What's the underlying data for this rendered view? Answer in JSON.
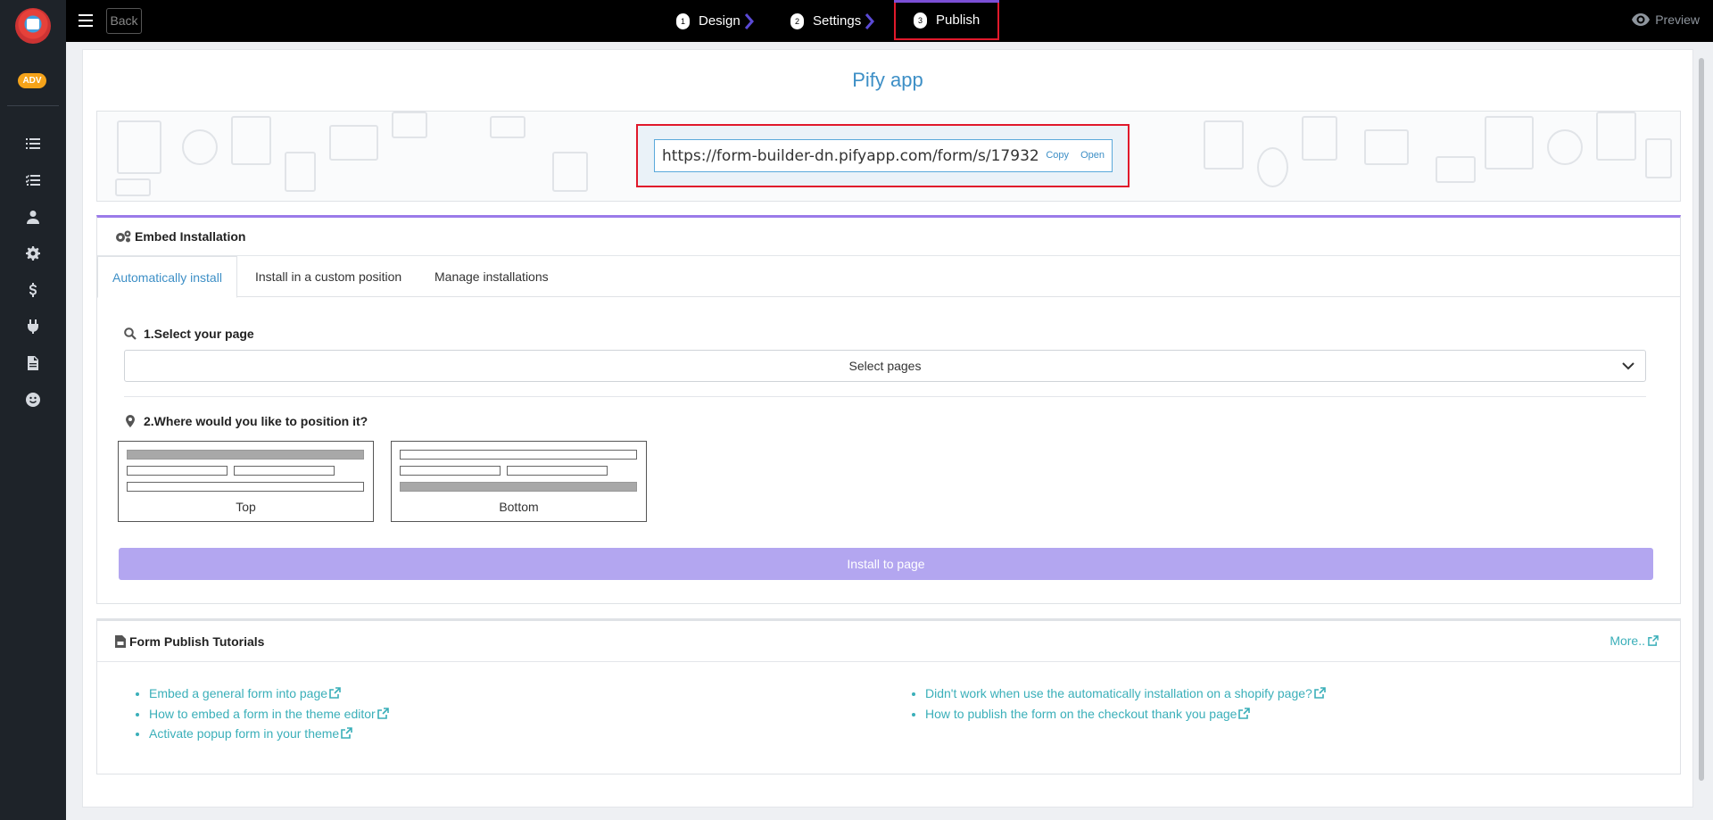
{
  "sidebar": {
    "badge": "ADV",
    "icons": [
      "list-icon",
      "checklist-icon",
      "user-icon",
      "gear-icon",
      "dollar-icon",
      "plug-icon",
      "document-icon",
      "smile-icon"
    ]
  },
  "topbar": {
    "back_label": "Back",
    "steps": [
      {
        "num": "1",
        "label": "Design"
      },
      {
        "num": "2",
        "label": "Settings"
      },
      {
        "num": "3",
        "label": "Publish"
      }
    ],
    "preview_label": "Preview"
  },
  "main": {
    "app_title": "Pify app",
    "form_url": "https://form-builder-dn.pifyapp.com/form/s/17932",
    "copy_label": "Copy",
    "open_label": "Open"
  },
  "embed": {
    "title": "Embed Installation",
    "tabs": [
      "Automatically install",
      "Install in a custom position",
      "Manage installations"
    ],
    "step1_label": "1.Select your page",
    "select_placeholder": "Select pages",
    "step2_label": "2.Where would you like to position it?",
    "positions": [
      "Top",
      "Bottom"
    ],
    "install_label": "Install to page"
  },
  "tutorials": {
    "title": "Form Publish Tutorials",
    "more_label": "More..",
    "left_items": [
      "Embed a general form into page",
      "How to embed a form in the theme editor",
      "Activate popup form in your theme"
    ],
    "right_items": [
      "Didn't work when use the automatically installation on a shopify page?",
      "How to publish the form on the checkout thank you page"
    ]
  },
  "colors": {
    "sidebar_bg": "#1e2329",
    "topbar_bg": "#000000",
    "accent_blue": "#3d8fc6",
    "link_teal": "#3aafb9",
    "purple": "#b3a6f0",
    "highlight_red": "#e0192b"
  }
}
